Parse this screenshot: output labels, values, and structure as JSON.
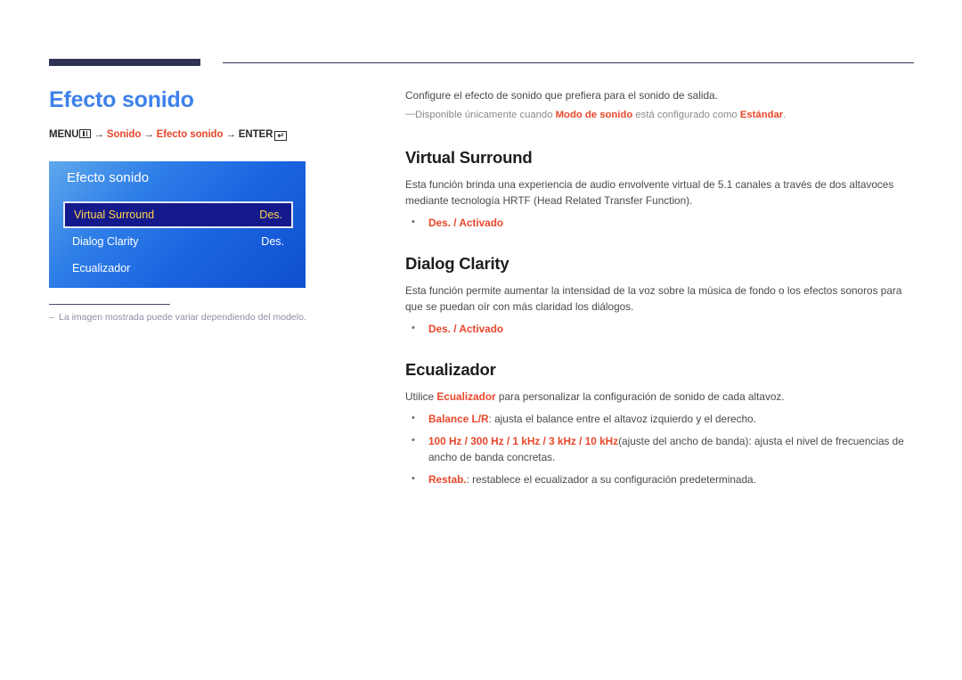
{
  "page": {
    "title": "Efecto sonido",
    "title_color": "#3d81ec",
    "accent_red": "#e8472b",
    "rule_color": "#2e3254"
  },
  "breadcrumb": {
    "menu_label": "MENU",
    "menu_icon": "menu-grid-icon",
    "arrow": "→",
    "item1": "Sonido",
    "item2": "Efecto sonido",
    "enter_label": "ENTER",
    "enter_icon": "enter-key-icon",
    "enter_glyph": "↵"
  },
  "osd": {
    "title": "Efecto sonido",
    "rows": [
      {
        "label": "Virtual Surround",
        "value": "Des.",
        "selected": true
      },
      {
        "label": "Dialog Clarity",
        "value": "Des.",
        "selected": false
      },
      {
        "label": "Ecualizador",
        "value": "",
        "selected": false
      }
    ],
    "highlight_bg": "#141a8c",
    "highlight_text": "#ffd24a"
  },
  "caption": {
    "dash": "–",
    "text": "La imagen mostrada puede variar dependiendo del modelo."
  },
  "content": {
    "intro": "Configure el efecto de sonido que prefiera para el sonido de salida.",
    "note": {
      "dash": "—",
      "part1": "Disponible únicamente cuando ",
      "bold1": "Modo de sonido",
      "part2": " está configurado como ",
      "bold2": "Estándar",
      "part3": "."
    },
    "sections": [
      {
        "heading": "Virtual Surround",
        "body": "Esta función brinda una experiencia de audio envolvente virtual de 5.1 canales a través de dos altavoces mediante tecnología HRTF (Head Related Transfer Function).",
        "bullets": [
          {
            "bold": "Des. / Activado",
            "rest": ""
          }
        ]
      },
      {
        "heading": "Dialog Clarity",
        "body": "Esta función permite aumentar la intensidad de la voz sobre la música de fondo o los efectos sonoros para que se puedan oír con más claridad los diálogos.",
        "bullets": [
          {
            "bold": "Des. / Activado",
            "rest": ""
          }
        ]
      },
      {
        "heading": "Ecualizador",
        "body_pre": "Utilice ",
        "body_bold": "Ecualizador",
        "body_post": " para personalizar la configuración de sonido de cada altavoz.",
        "bullets": [
          {
            "bold": "Balance L/R",
            "rest": ": ajusta el balance entre el altavoz izquierdo y el derecho."
          },
          {
            "bold": "100 Hz / 300 Hz / 1 kHz / 3 kHz / 10 kHz",
            "rest": "(ajuste del ancho de banda): ajusta el nivel de frecuencias de ancho de banda concretas."
          },
          {
            "bold": "Restab.",
            "rest": ": restablece el ecualizador a su configuración predeterminada."
          }
        ]
      }
    ]
  }
}
